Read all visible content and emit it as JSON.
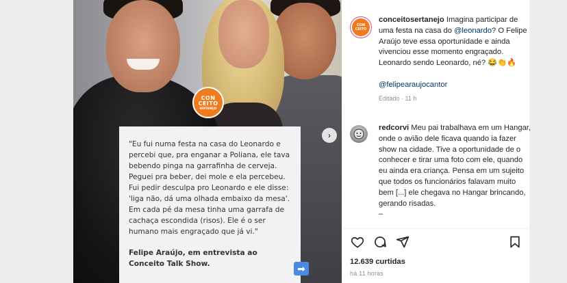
{
  "post": {
    "card": {
      "logo": {
        "line1": "CON",
        "line2": "CEITO",
        "line3": "SERTANEJO"
      },
      "quote": "\"Eu fui numa festa na casa do Leonardo e percebi que, pra enganar a Poliana, ele tava bebendo pinga na garrafinha de cerveja. Peguei pra beber, dei mole e ela percebeu. Fui pedir desculpa pro Leonardo e ele disse: 'liga não, dá uma olhada embaixo da mesa'. Em cada pé da mesa tinha uma garrafa de cachaça escondida (risos). Ele é o ser humano mais engraçado que já vi.\"",
      "author": "Felipe Araújo, em entrevista ao Conceito Talk Show.",
      "arrow_icon": "➡"
    },
    "carousel_next_icon": "›"
  },
  "panel": {
    "account": {
      "username": "conceitosertanejo",
      "avatar_text": "CON CEITO"
    },
    "caption": {
      "text_1": " Imagina participar de uma festa na casa do ",
      "mention": "@leonardo",
      "text_2": "? O Felipe Araújo teve essa oportunidade e ainda vivenciou esse momento engraçado. Leonardo sendo Leonardo, né? 😂👏🔥",
      "tag": "@felipearaujocantor",
      "edited": "Editado · 11 h"
    },
    "comment": {
      "username": "redcorvi",
      "text": " Meu pai trabalhava em um Hangar, onde o avião dele ficava quando ia fazer show na cidade. Tive a oportunidade de o conhecer e tirar uma foto com ele, quando eu ainda era criança. Pensa em um sujeito que todos os funcionários falavam muito bem [...] ele chegava no Hangar brincando, gerando risadas.",
      "trail": "–"
    },
    "likes": "12.639 curtidas",
    "timestamp": "há 11 horas"
  }
}
